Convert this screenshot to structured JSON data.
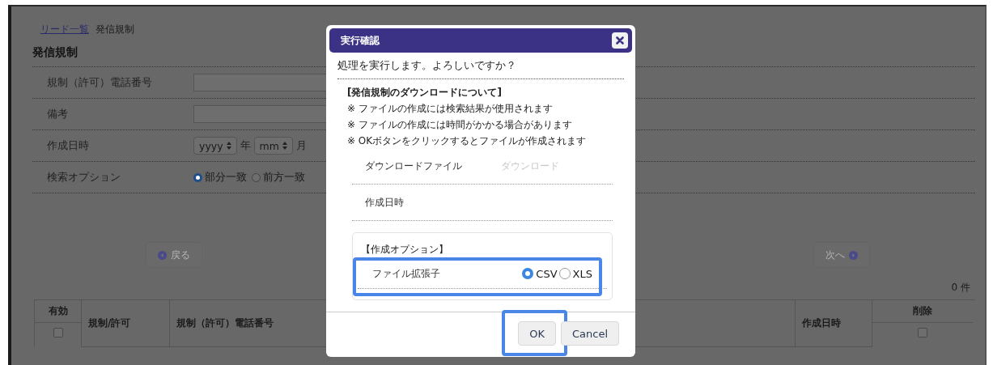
{
  "breadcrumb": [
    {
      "kind": "link",
      "label": "リード一覧"
    },
    {
      "kind": "current",
      "label": "発信規制"
    }
  ],
  "page_title": "発信規制",
  "form_rows": [
    {
      "kind": "text",
      "label": "規制（許可）電話番号"
    },
    {
      "kind": "text",
      "label": "備考"
    },
    {
      "kind": "date",
      "label": "作成日時",
      "selects": [
        {
          "value": "yyyy",
          "unit": "年"
        },
        {
          "value": "mm",
          "unit": "月"
        }
      ]
    },
    {
      "kind": "radio",
      "label": "検索オプション",
      "options": [
        {
          "label": "部分一致",
          "selected": true
        },
        {
          "label": "前方一致",
          "selected": false
        }
      ]
    }
  ],
  "pager": {
    "prev": {
      "label": "戻る",
      "disabled": true
    },
    "next": {
      "label": "次へ",
      "disabled": true
    }
  },
  "count": "0 件",
  "table": {
    "columns": [
      {
        "label": "有効",
        "kind": "check",
        "checked": false
      },
      {
        "label": "規制/許可",
        "kind": "text"
      },
      {
        "label": "規制（許可）電話番号",
        "kind": "text"
      },
      {
        "label": "作成日時",
        "kind": "text"
      },
      {
        "label": "削除",
        "kind": "check",
        "checked": false
      }
    ]
  },
  "dialog": {
    "title": "実行確認",
    "message": "処理を実行します。よろしいですか？",
    "info_heading": "[発信規制のダウンロードについて]",
    "notes": [
      "※ ファイルの作成には検索結果が使用されます",
      "※ ファイルの作成には時間がかかる場合があります",
      "※ OKボタンをクリックするとファイルが作成されます"
    ],
    "fields": [
      {
        "label": "ダウンロードファイル",
        "value": "ダウンロード",
        "disabled": true
      },
      {
        "label": "作成日時"
      }
    ],
    "options": {
      "heading": "【作成オプション】",
      "label": "ファイル拡張子",
      "highlight": true,
      "choices": [
        {
          "label": "CSV",
          "selected": true
        },
        {
          "label": "XLS",
          "selected": false
        }
      ]
    },
    "buttons": [
      {
        "label": "OK",
        "highlight": true
      },
      {
        "label": "Cancel",
        "highlight": false
      }
    ]
  }
}
